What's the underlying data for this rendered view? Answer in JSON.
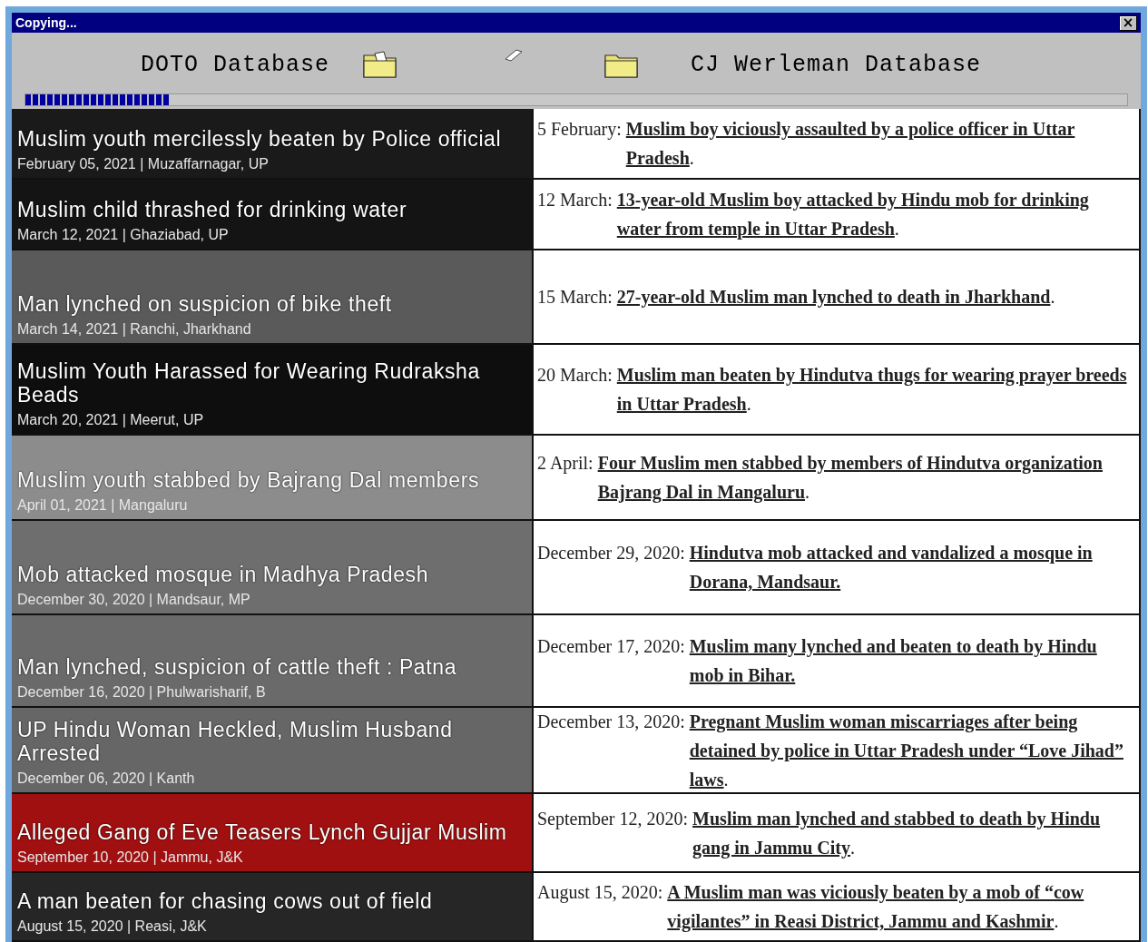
{
  "window": {
    "title": "Copying...",
    "close": "×"
  },
  "copy": {
    "source": "DOTO Database",
    "destination": "CJ Werleman Database",
    "level": 0.13
  },
  "rows": [
    {
      "color": "#1a1a1a",
      "title": "Muslim youth mercilessly beaten by Police official",
      "meta": "February 05, 2021 | Muzaffarnagar, UP",
      "date": "5 February: ",
      "link": "Muslim boy viciously assaulted by a police officer in Uttar Pradesh",
      "after": "."
    },
    {
      "color": "#141414",
      "title": "Muslim child thrashed for drinking water",
      "meta": "March 12, 2021 | Ghaziabad, UP",
      "date": "12 March: ",
      "link": "13-year-old Muslim boy attacked by Hindu mob for drinking water from temple in Uttar Pradesh",
      "after": "."
    },
    {
      "color": "#5a5a5a",
      "title": "Man lynched on suspicion of bike theft",
      "meta": "March 14, 2021 | Ranchi, Jharkhand",
      "date": "15 March: ",
      "link": "27-year-old Muslim man lynched to death in Jharkhand",
      "after": "."
    },
    {
      "color": "#0e0e0e",
      "title": "Muslim Youth Harassed for Wearing Rudraksha Beads",
      "meta": "March 20, 2021 | Meerut, UP",
      "date": "20 March: ",
      "link": "Muslim man beaten by Hindutva thugs for wearing prayer breeds in Uttar Pradesh",
      "after": "."
    },
    {
      "color": "#8c8c8c",
      "title": "Muslim youth stabbed by Bajrang Dal members",
      "meta": "April 01, 2021 | Mangaluru",
      "date": "2 April: ",
      "link": "Four Muslim men stabbed by members of Hindutva organization Bajrang Dal in Mangaluru",
      "after": "."
    },
    {
      "color": "#6e6e6e",
      "title": "Mob attacked mosque in Madhya Pradesh",
      "meta": "December 30, 2020 | Mandsaur, MP",
      "date": "December 29, 2020: ",
      "link": "Hindutva mob attacked and vandalized a mosque in Dorana, Mandsaur."
    },
    {
      "color": "#6a6a6a",
      "title": "Man lynched, suspicion of cattle theft : Patna",
      "meta": "December 16, 2020 | Phulwarisharif, B",
      "date": "December 17, 2020: ",
      "link": "Muslim many lynched and beaten to death by Hindu mob in Bihar."
    },
    {
      "color": "#666666",
      "title": "UP Hindu Woman Heckled, Muslim Husband Arrested",
      "meta": "December 06, 2020 | Kanth",
      "date": "December 13, 2020: ",
      "link": "Pregnant Muslim woman miscarriages after being detained by police in Uttar Pradesh under “Love Jihad” laws",
      "after": "."
    },
    {
      "color": "#a01010",
      "title": "Alleged Gang of Eve Teasers Lynch Gujjar Muslim",
      "meta": "September 10, 2020 | Jammu, J&K",
      "date": "September 12, 2020: ",
      "link": "Muslim man lynched and stabbed to death by Hindu gang in Jammu City",
      "after": "."
    },
    {
      "color": "#262626",
      "title": "A man beaten for chasing cows out of field",
      "meta": "August 15, 2020 | Reasi, J&K",
      "date": "August 15, 2020: ",
      "link": "A Muslim man was viciously beaten by a mob of “cow vigilantes” in Reasi District, Jammu and Kashmir",
      "after": "."
    }
  ]
}
